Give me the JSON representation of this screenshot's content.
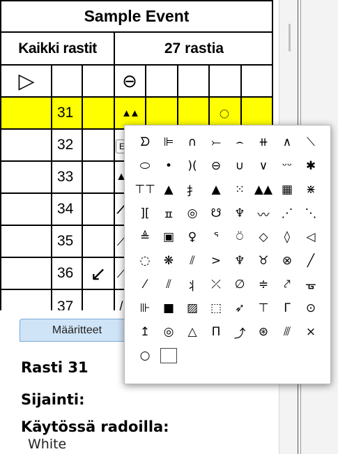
{
  "sheet": {
    "title": "Sample Event",
    "controls_label": "Kaikki rastit",
    "count_label": "27 rastia",
    "rows": [
      {
        "number": "31"
      },
      {
        "number": "32"
      },
      {
        "number": "33"
      },
      {
        "number": "34"
      },
      {
        "number": "35"
      },
      {
        "number": "36"
      },
      {
        "number": "37"
      }
    ],
    "row_symbols": {
      "start": "▷",
      "dot_knoll": "⊖",
      "r31_feature": "▲▲",
      "r31_detail": "◌",
      "r32_partial": "E",
      "r33_partial": "▲",
      "r34_partial": "⟋",
      "r35_partial": "⟋",
      "r36_direction": "↙",
      "r36_partial": "⟋",
      "r37_partial": "/"
    }
  },
  "button": {
    "label": "Määritteet"
  },
  "info": {
    "control": "Rasti 31",
    "location_label": "Sijainti:",
    "courses_label": "Käytössä radoilla:",
    "course": "White"
  },
  "popup_symbols": [
    "ᗤ",
    "⊫",
    "∩",
    "⤚",
    "⌢",
    "⧺",
    "∧",
    "⟍",
    "⬭",
    "•",
    ")(",
    "⊖",
    "∪",
    "∨",
    "ᵕᵕ",
    "✱",
    "⊤⊤",
    "▲",
    "⺘",
    "▲",
    "⁙",
    "▲▲",
    "▦",
    "⋇",
    "][",
    "ㅍ",
    "◎",
    "☋",
    "♆",
    "〰",
    "⋰",
    "⋱",
    "≜",
    "▣",
    "♀",
    "ᕐ",
    "⍥",
    "◇",
    "◊",
    "◁",
    "◌",
    "❋",
    "⫽",
    ">",
    "♆",
    "♉",
    "⊗",
    "╱",
    "⁄",
    "⫽",
    "⺦",
    "⤫",
    "∅",
    "≑",
    "⤤",
    "ᚗ",
    "⊪",
    "■",
    "▨",
    "⬚",
    "➶",
    "⊤",
    "Γ",
    "⊙",
    "↥",
    "◎",
    "△",
    "Π",
    "⤴",
    "⊛",
    "⫻",
    "×",
    "○",
    "☐"
  ],
  "colors": {
    "highlight": "#ffff00",
    "button_bg": "#cfe4f7"
  }
}
